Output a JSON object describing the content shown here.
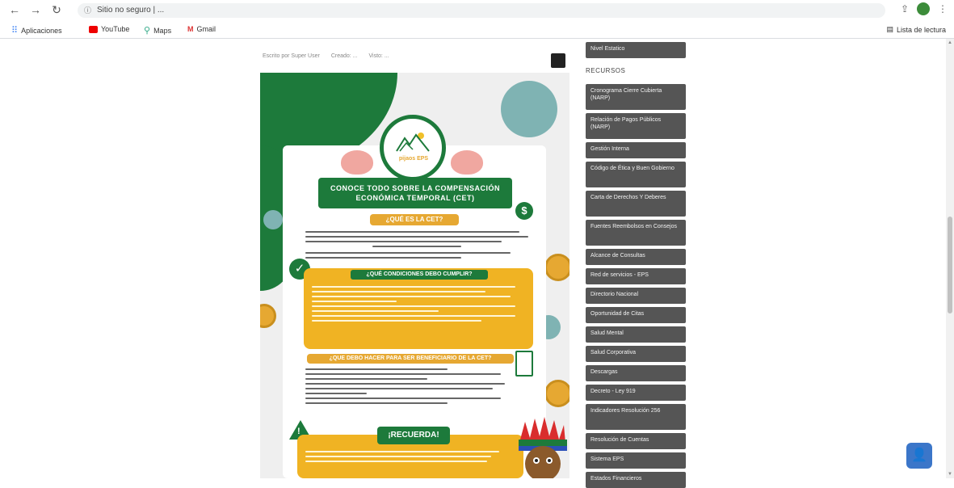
{
  "browser": {
    "url": "Sitio no seguro | ...",
    "bookmarks": {
      "apps": "Aplicaciones",
      "youtube": "YouTube",
      "maps": "Maps",
      "gmail": "Gmail"
    },
    "reading_list": "Lista de lectura"
  },
  "post": {
    "title": "",
    "meta": {
      "author": "Escrito por Super User",
      "category": "Creado: ...",
      "hits": "Visto: ..."
    }
  },
  "infographic": {
    "logo_label": "pijaos EPS",
    "banner": "CONOCE TODO SOBRE LA COMPENSACIÓN ECONÓMICA TEMPORAL (CET)",
    "q1": "¿QUÉ ES LA CET?",
    "q2": "¿QUÉ CONDICIONES DEBO CUMPLIR?",
    "q3": "¿QUE DEBO HACER PARA SER BENEFICIARIO DE LA CET?",
    "remember": "¡RECUERDA!",
    "dollar": "$",
    "check": "✓",
    "warn": "!"
  },
  "sidebar": {
    "top_item": "Nivel Estatico",
    "resources_heading": "RECURSOS",
    "items": [
      "Cronograma Cierre Cubierta (NARP)",
      "Relación de Pagos Públicos (NARP)",
      "Gestión Interna",
      "Código de Ética y Buen Gobierno",
      "Carta de Derechos Y Deberes",
      "Fuentes Reembolsos en Consejos",
      "Alcance de Consultas",
      "Red de servicios - EPS",
      "Directorio Nacional",
      "Oportunidad de Citas",
      "Salud Mental",
      "Salud Corporativa",
      "Descargas",
      "Decreto - Ley 919",
      "Indicadores Resolución 256",
      "Resolución de Cuentas",
      "Sistema EPS",
      "Estados Financieros"
    ]
  },
  "colors": {
    "green": "#1d7a3b",
    "yellow": "#f0b323",
    "sidebar": "#555555"
  }
}
